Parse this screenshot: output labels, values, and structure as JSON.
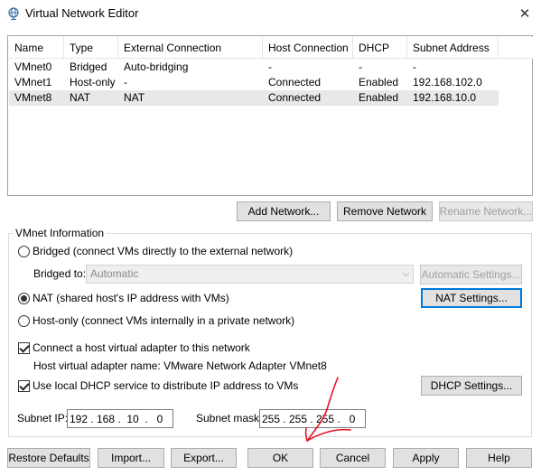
{
  "window": {
    "title": "Virtual Network Editor",
    "close_glyph": "✕"
  },
  "table": {
    "columns": [
      "Name",
      "Type",
      "External Connection",
      "Host Connection",
      "DHCP",
      "Subnet Address"
    ],
    "rows": [
      [
        "VMnet0",
        "Bridged",
        "Auto-bridging",
        "-",
        "-",
        "-"
      ],
      [
        "VMnet1",
        "Host-only",
        "-",
        "Connected",
        "Enabled",
        "192.168.102.0"
      ],
      [
        "VMnet8",
        "NAT",
        "NAT",
        "Connected",
        "Enabled",
        "192.168.10.0"
      ]
    ],
    "selected_row": 2
  },
  "network_buttons": {
    "add": "Add Network...",
    "remove": "Remove Network",
    "rename": "Rename Network..."
  },
  "vmnet_info": {
    "title": "VMnet Information",
    "bridged_label": "Bridged (connect VMs directly to the external network)",
    "bridged_to_label": "Bridged to:",
    "bridged_to_value": "Automatic",
    "automatic_settings": "Automatic Settings...",
    "nat_label": "NAT (shared host's IP address with VMs)",
    "nat_settings": "NAT Settings...",
    "hostonly_label": "Host-only (connect VMs internally in a private network)",
    "connect_adapter_label": "Connect a host virtual adapter to this network",
    "adapter_name_text": "Host virtual adapter name: VMware Network Adapter VMnet8",
    "dhcp_label": "Use local DHCP service to distribute IP address to VMs",
    "dhcp_settings": "DHCP Settings...",
    "subnet_ip_label": "Subnet IP:",
    "subnet_ip": [
      "192",
      "168",
      "10",
      "0"
    ],
    "subnet_mask_label": "Subnet mask:",
    "subnet_mask": [
      "255",
      "255",
      "255",
      "0"
    ]
  },
  "footer_buttons": {
    "restore": "Restore Defaults",
    "import": "Import...",
    "export": "Export...",
    "ok": "OK",
    "cancel": "Cancel",
    "apply": "Apply",
    "help": "Help"
  },
  "colors": {
    "annotation_arrow": "#e81123",
    "focus_border": "#0078d7"
  },
  "icons": {
    "title": "network-globe-icon",
    "close": "close-icon",
    "dropdown": "chevron-down-icon"
  }
}
